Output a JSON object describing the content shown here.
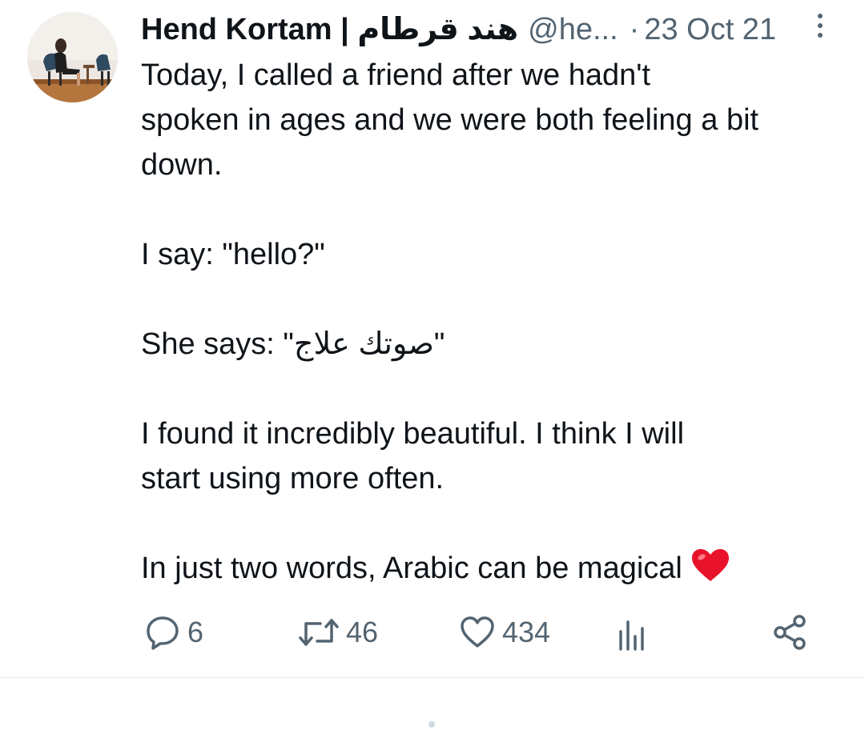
{
  "tweet": {
    "author": {
      "display_name": "Hend Kortam | هند قرطام",
      "handle": "@he...",
      "avatar_icon": "profile-photo"
    },
    "separator": "·",
    "date": "23 Oct 21",
    "more_icon": "more-vertical-icon",
    "paragraphs": [
      "Today, I called a friend after we hadn't\nspoken in ages and we were both feeling a bit\ndown.",
      "I say: \"hello?\"",
      "She says: \"صوتك علاج\"",
      "I found it incredibly beautiful. I think I will\nstart using more often.",
      "In just two words, Arabic can be magical"
    ],
    "emoji": "red-heart",
    "actions": {
      "reply": {
        "icon": "reply-icon",
        "count": "6"
      },
      "retweet": {
        "icon": "retweet-icon",
        "count": "46"
      },
      "like": {
        "icon": "heart-icon",
        "count": "434"
      },
      "views": {
        "icon": "views-chart-icon"
      },
      "share": {
        "icon": "share-icon"
      }
    },
    "colors": {
      "text": "#0f1419",
      "secondary": "#536471",
      "heart_emoji": "#e8132b",
      "divider": "#e6e9ec"
    }
  }
}
